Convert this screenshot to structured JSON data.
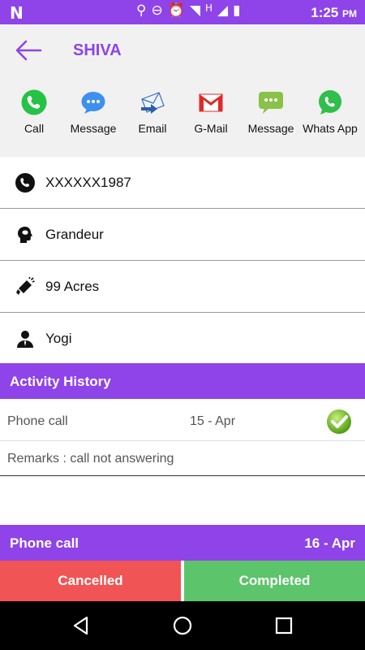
{
  "status_bar": {
    "carrier_logo": "N",
    "icons": [
      "location-icon",
      "dnd-icon",
      "alarm-icon",
      "wifi-icon",
      "h-network-icon",
      "signal-icon",
      "battery-icon"
    ],
    "network_letter": "H",
    "time": "1:25",
    "ampm": "PM"
  },
  "header": {
    "title": "SHIVA"
  },
  "actions": [
    {
      "label": "Call",
      "icon": "phone-icon",
      "color": "#25c246"
    },
    {
      "label": "Message",
      "icon": "message-bubble-icon",
      "color": "#3d8ff0"
    },
    {
      "label": "Email",
      "icon": "email-icon",
      "color": "#3a6fb5"
    },
    {
      "label": "G-Mail",
      "icon": "gmail-icon",
      "color": "#e02a2a"
    },
    {
      "label": "Message",
      "icon": "sms-icon",
      "color": "#8ac148"
    },
    {
      "label": "Whats App",
      "icon": "whatsapp-icon",
      "color": "#2fbf4a"
    }
  ],
  "details": {
    "phone": "XXXXXX1987",
    "project": "Grandeur",
    "source": "99 Acres",
    "agent": "Yogi"
  },
  "activity_history": {
    "title": "Activity History",
    "entry": {
      "type": "Phone call",
      "date": "15 - Apr",
      "status_icon": "check-icon",
      "remarks": "Remarks : call not answering"
    }
  },
  "next_activity": {
    "type": "Phone call",
    "date": "16 - Apr"
  },
  "buttons": {
    "cancelled": "Cancelled",
    "completed": "Completed"
  },
  "colors": {
    "accent": "#8e44e8",
    "cancel": "#f05454",
    "complete": "#5cc46a"
  }
}
